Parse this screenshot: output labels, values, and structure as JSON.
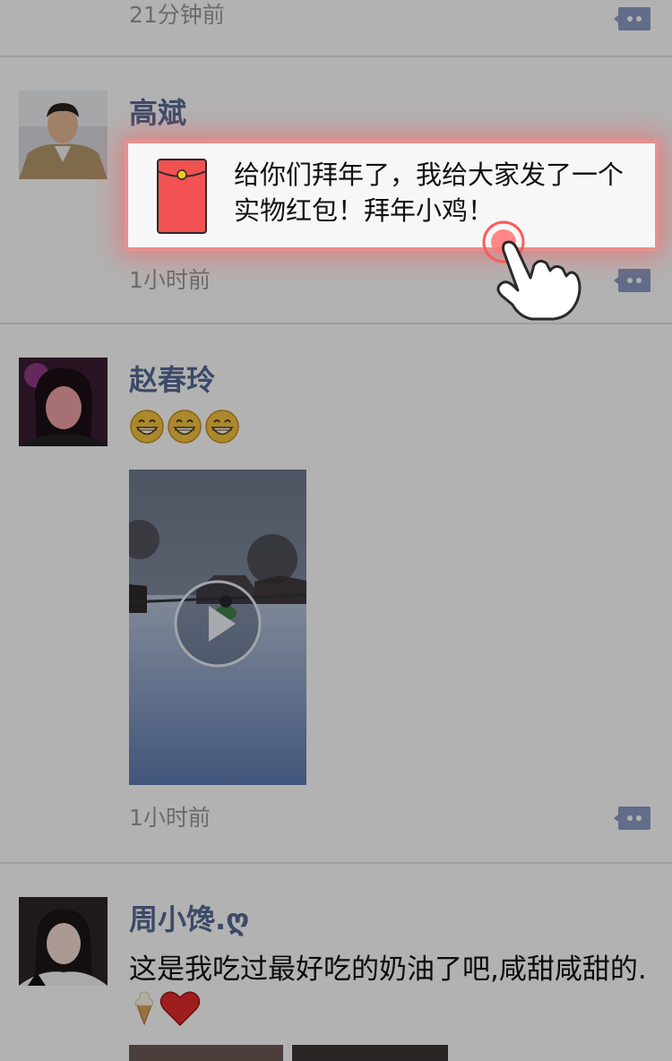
{
  "posts": [
    {
      "time": "21分钟前"
    },
    {
      "author": "高斌",
      "red_packet_text": "给你们拜年了，我给大家发了一个实物红包！拜年小鸡！",
      "time": "1小时前"
    },
    {
      "author": "赵春玲",
      "emoji_count": 3,
      "emoji_icon": "grinning-face-emoji",
      "video_icon": "play-icon",
      "time": "1小时前"
    },
    {
      "author": "周小馋.ღ",
      "text": "这是我吃过最好吃的奶油了吧,咸甜咸甜的.",
      "text_emojis": [
        "soft-ice-cream-emoji",
        "red-heart-emoji"
      ]
    }
  ],
  "colors": {
    "author_link": "#576b95",
    "time": "#9a9a9a",
    "red_packet": "#f25252",
    "highlight_glow": "#ff5a5a",
    "overlay": "rgba(0,0,0,0.30)"
  },
  "guide": {
    "icon": "tap-hand-icon"
  }
}
